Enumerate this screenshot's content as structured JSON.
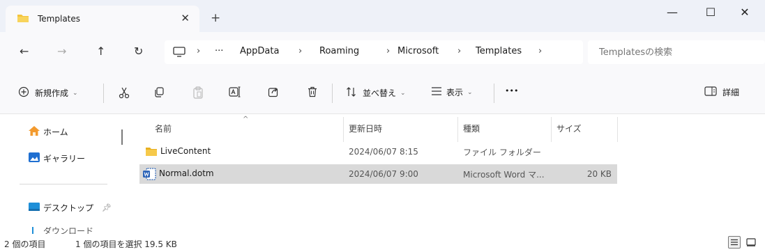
{
  "window": {
    "tab_title": "Templates",
    "tab_close": "✕",
    "new_tab": "+",
    "minimize": "—",
    "maximize": "☐",
    "close": "✕"
  },
  "nav": {
    "back": "←",
    "forward": "→",
    "up": "↑",
    "refresh": "↻",
    "more_crumbs": "···",
    "crumbs": [
      "AppData",
      "Roaming",
      "Microsoft",
      "Templates"
    ],
    "separator": "›",
    "search_placeholder": "Templatesの検索"
  },
  "toolbar": {
    "new_label": "新規作成",
    "sort_label": "並べ替え",
    "view_label": "表示",
    "more": "•••",
    "details_label": "詳細"
  },
  "sidebar": {
    "items": [
      {
        "label": "ホーム"
      },
      {
        "label": "ギャラリー"
      },
      {
        "label": "デスクトップ"
      },
      {
        "label": "ダウンロード"
      }
    ]
  },
  "columns": {
    "name": "名前",
    "date": "更新日時",
    "type": "種類",
    "size": "サイズ",
    "sort_indicator": "^"
  },
  "files": [
    {
      "name": "LiveContent",
      "date": "2024/06/07 8:15",
      "type": "ファイル フォルダー",
      "size": "",
      "icon": "folder-icon",
      "selected": false
    },
    {
      "name": "Normal.dotm",
      "date": "2024/06/07 9:00",
      "type": "Microsoft Word マ...",
      "size": "20 KB",
      "icon": "word-template-icon",
      "selected": true
    }
  ],
  "status": {
    "item_count": "2 個の項目",
    "selection": "1 個の項目を選択  19.5 KB"
  },
  "colors": {
    "folder": "#f4c43c",
    "accent_blue": "#1f6fd1",
    "selected_row": "#d9d9d9"
  }
}
